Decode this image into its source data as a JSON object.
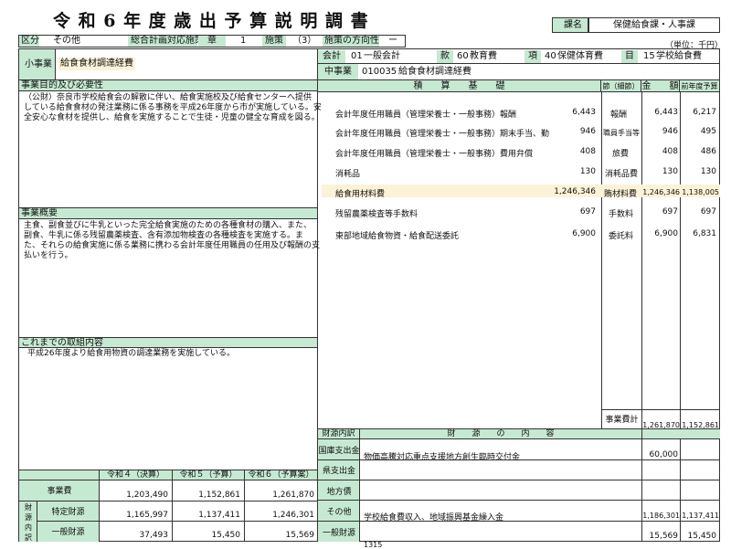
{
  "title": "令 和 6 年 度 歳 出 予 算 説 明 調 書",
  "section": {
    "label": "課名",
    "value": "保健給食課・人事課"
  },
  "unit": "（単位：千円）",
  "plan": {
    "kubun_label": "区分",
    "kubun_value": "その他",
    "sougou_label": "総合計画対応施策",
    "shou_label": "章",
    "shou_value": "1",
    "shisaku_label": "施策",
    "shisaku_value": "（3）",
    "houkou_label": "施策の方向性",
    "houkou_value": "ー"
  },
  "accounts": {
    "kaikei_label": "会計",
    "kaikei_code": "01",
    "kaikei_name": "一般会計",
    "kan_label": "款",
    "kan_code": "60",
    "kan_name": "教育費",
    "kou_label": "項",
    "kou_code": "40",
    "kou_name": "保健体育費",
    "moku_label": "目",
    "moku_code": "15",
    "moku_name": "学校給食費",
    "chu_label": "中事業",
    "chu_code": "010035",
    "chu_name": "給食食材調達経費"
  },
  "sho_jigyo": {
    "label": "小事業",
    "value": "給食食材調達経費"
  },
  "purpose": {
    "label": "事業目的及び必要性",
    "lines": [
      "（公財）奈良市学校給食会の解散に伴い、給食実施校及び給食センターへ提供",
      "している給食食材の発注業務に係る事務を平成26年度から市が実施している。安",
      "全安心な食材を提供し、給食を実施することで生徒・児童の健全な育成を図る。"
    ]
  },
  "overview": {
    "label": "事業概要",
    "lines": [
      "主食、副食並びに牛乳といった完全給食実施のための各種食材の購入、また、",
      "副食、牛乳に係る残留農薬検査、含有添加物検査の各種検査を実施する。ま",
      "た、それらの給食実施に係る業務に携わる会計年度任用職員の任用及び報酬の支",
      "払いを行う。"
    ]
  },
  "history": {
    "label": "これまでの取組内容",
    "lines": [
      "平成26年度より給食用物資の調達業務を実施している。"
    ]
  },
  "estimate": {
    "header": "積　　算　　基　　礎",
    "setsu_header": "節（細節）",
    "kingaku_header": "金　　額",
    "prev_header": "前年度予算",
    "rows": [
      {
        "name": "会計年度任用職員（管理栄養士・一般事務）報酬",
        "amount": "6,443",
        "setsu": "報酬",
        "kingaku": "6,443",
        "prev": "6,217",
        "hl": false
      },
      {
        "name": "会計年度任用職員（管理栄養士・一般事務）期末手当、勤",
        "amount": "946",
        "setsu": "職員手当等",
        "kingaku": "946",
        "prev": "495",
        "hl": false
      },
      {
        "name": "会計年度任用職員（管理栄養士・一般事務）費用弁償",
        "amount": "408",
        "setsu": "旅費",
        "kingaku": "408",
        "prev": "486",
        "hl": false
      },
      {
        "name": "消耗品",
        "amount": "130",
        "setsu": "消耗品費",
        "kingaku": "130",
        "prev": "130",
        "hl": false
      },
      {
        "name": "給食用材料費",
        "amount": "1,246,346",
        "setsu": "賄材料費",
        "kingaku": "1,246,346",
        "prev": "1,138,005",
        "hl": true
      },
      {
        "name": "残留農薬検査等手数料",
        "amount": "697",
        "setsu": "手数料",
        "kingaku": "697",
        "prev": "697",
        "hl": false
      },
      {
        "name": "東部地域給食物資・給食配送委託",
        "amount": "6,900",
        "setsu": "委託料",
        "kingaku": "6,900",
        "prev": "6,831",
        "hl": false
      }
    ],
    "total_label": "事業費計",
    "total_kingaku": "1,261,870",
    "total_prev": "1,152,861"
  },
  "funding": {
    "header_label": "財源内訳",
    "header_content": "財　　源　　の　　内　　容",
    "rows": [
      {
        "label": "国庫支出金",
        "content": "物価高騰対応重点支援地方創生臨時交付金",
        "kingaku": "60,000",
        "prev": ""
      },
      {
        "label": "県支出金",
        "content": "",
        "kingaku": "",
        "prev": ""
      },
      {
        "label": "地方債",
        "content": "",
        "kingaku": "",
        "prev": ""
      },
      {
        "label": "その他",
        "content": "学校給食費収入、地域振興基金繰入金",
        "kingaku": "1,186,301",
        "prev": "1,137,411"
      },
      {
        "label": "一般財源",
        "content": "",
        "kingaku": "15,569",
        "prev": "15,450"
      }
    ]
  },
  "summary": {
    "headers": [
      "令和４（決算）",
      "令和５（予算）",
      "令和６（予算案）"
    ],
    "jigyohi_label": "事業費",
    "jigyohi": [
      "1,203,490",
      "1,152,861",
      "1,261,870"
    ],
    "zaigen_label": "財源内訳",
    "tokutei_label": "特定財源",
    "tokutei": [
      "1,165,997",
      "1,137,411",
      "1,246,301"
    ],
    "ippan_label": "一般財源",
    "ippan": [
      "37,493",
      "15,450",
      "15,569"
    ]
  },
  "page_number": "1315"
}
